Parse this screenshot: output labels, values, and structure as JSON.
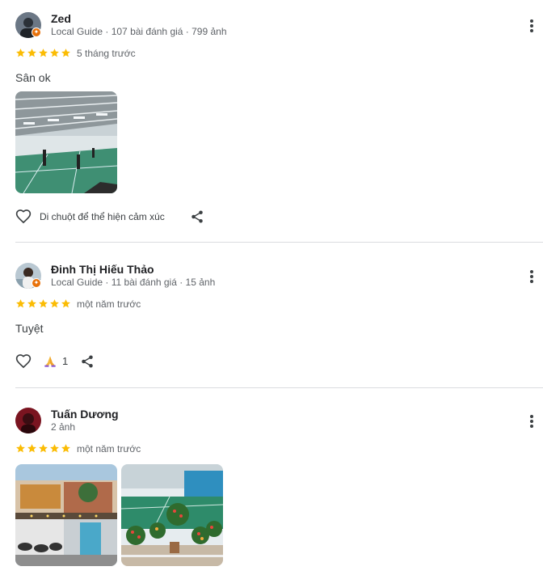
{
  "reviews": [
    {
      "name": "Zed",
      "meta": "Local Guide · 107 bài đánh giá · 799 ảnh",
      "rating": 5,
      "time": "5 tháng trước",
      "text": "Sân ok",
      "photo_count": 1,
      "reaction_label": "Di chuột để thể hiện cảm xúc"
    },
    {
      "name": "Đinh Thị Hiếu Thảo",
      "meta": "Local Guide · 11 bài đánh giá · 15 ảnh",
      "rating": 5,
      "time": "một năm trước",
      "text": "Tuyệt",
      "photo_count": 0,
      "reaction_count": "1"
    },
    {
      "name": "Tuấn Dương",
      "meta": "2 ảnh",
      "rating": 5,
      "time": "một năm trước",
      "photo_count": 2
    }
  ],
  "colors": {
    "star": "#fbbc04",
    "guide_badge": "#e8710a",
    "divider": "#dadce0",
    "meta_text": "#5f6368"
  },
  "icons": {
    "more": "more-vert-icon",
    "like": "heart-outline-icon",
    "share": "share-icon",
    "reaction": "praying-hands-icon",
    "star": "star-icon",
    "guide": "local-guide-badge-icon"
  }
}
